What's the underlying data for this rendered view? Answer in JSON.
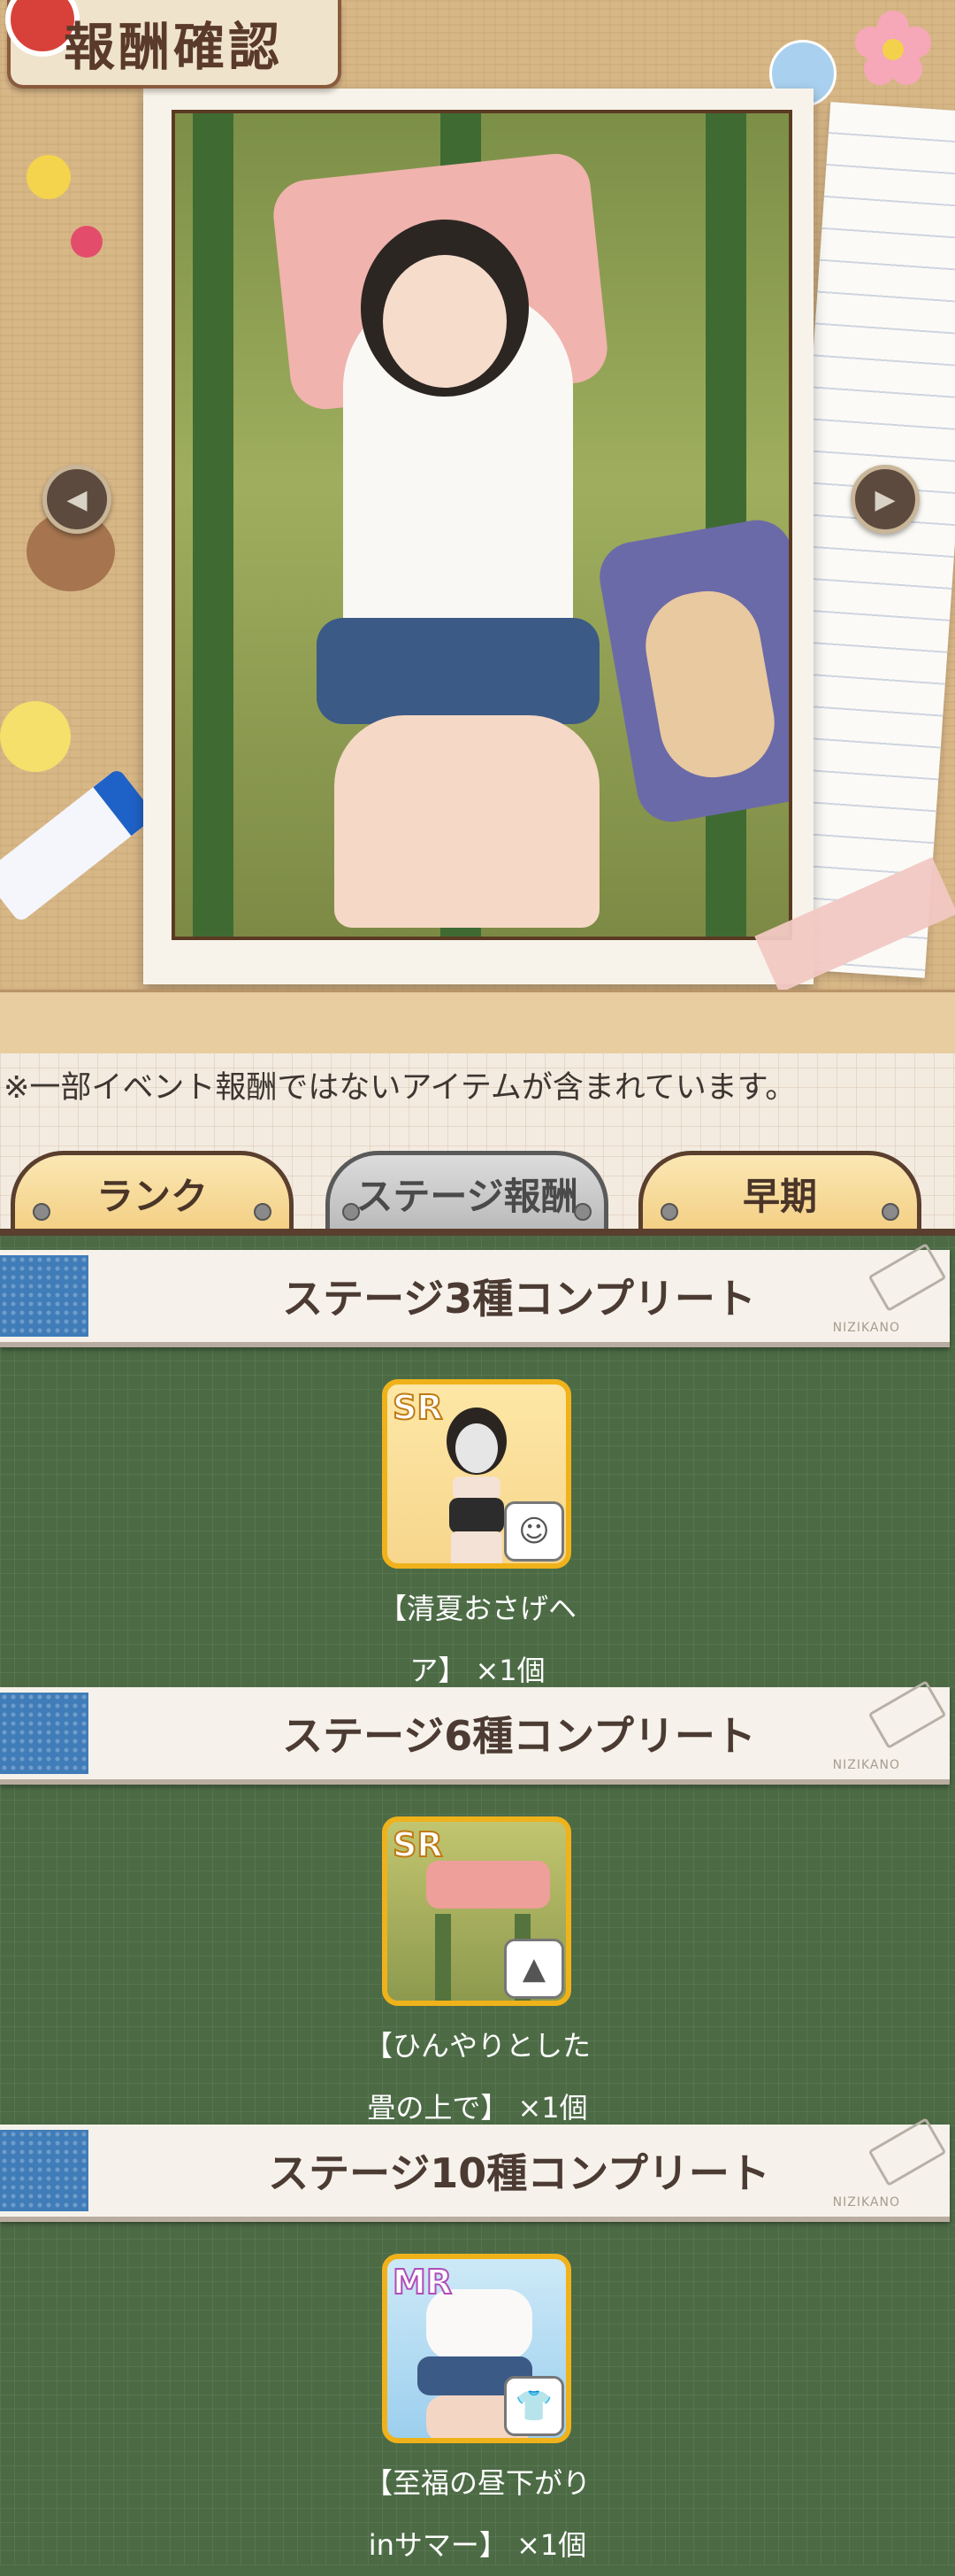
{
  "header": {
    "title": "報酬確認"
  },
  "notice": "※一部イベント報酬ではないアイテムが含まれています。",
  "tabs": [
    {
      "label": "ランク"
    },
    {
      "label": "ステージ報酬"
    },
    {
      "label": "早期"
    }
  ],
  "sections": [
    {
      "title": "ステージ3種コンプリート",
      "brand": "NIZIKANO",
      "card_rank": "SR",
      "badge_icon": "avatar-icon",
      "item_line1": "【清夏おさげヘ",
      "item_line2": "ア】 ×1個"
    },
    {
      "title": "ステージ6種コンプリート",
      "brand": "NIZIKANO",
      "card_rank": "SR",
      "badge_icon": "image-icon",
      "item_line1": "【ひんやりとした",
      "item_line2": "畳の上で】 ×1個"
    },
    {
      "title": "ステージ10種コンプリート",
      "brand": "NIZIKANO",
      "card_rank": "MR",
      "badge_icon": "outfit-icon",
      "item_line1": "【至福の昼下がり",
      "item_line2": "inサマー】 ×1個"
    }
  ],
  "colors": {
    "accent_gold": "#f0b21b",
    "list_green": "#4c6b45",
    "tab_active": "#b9b9b9"
  }
}
